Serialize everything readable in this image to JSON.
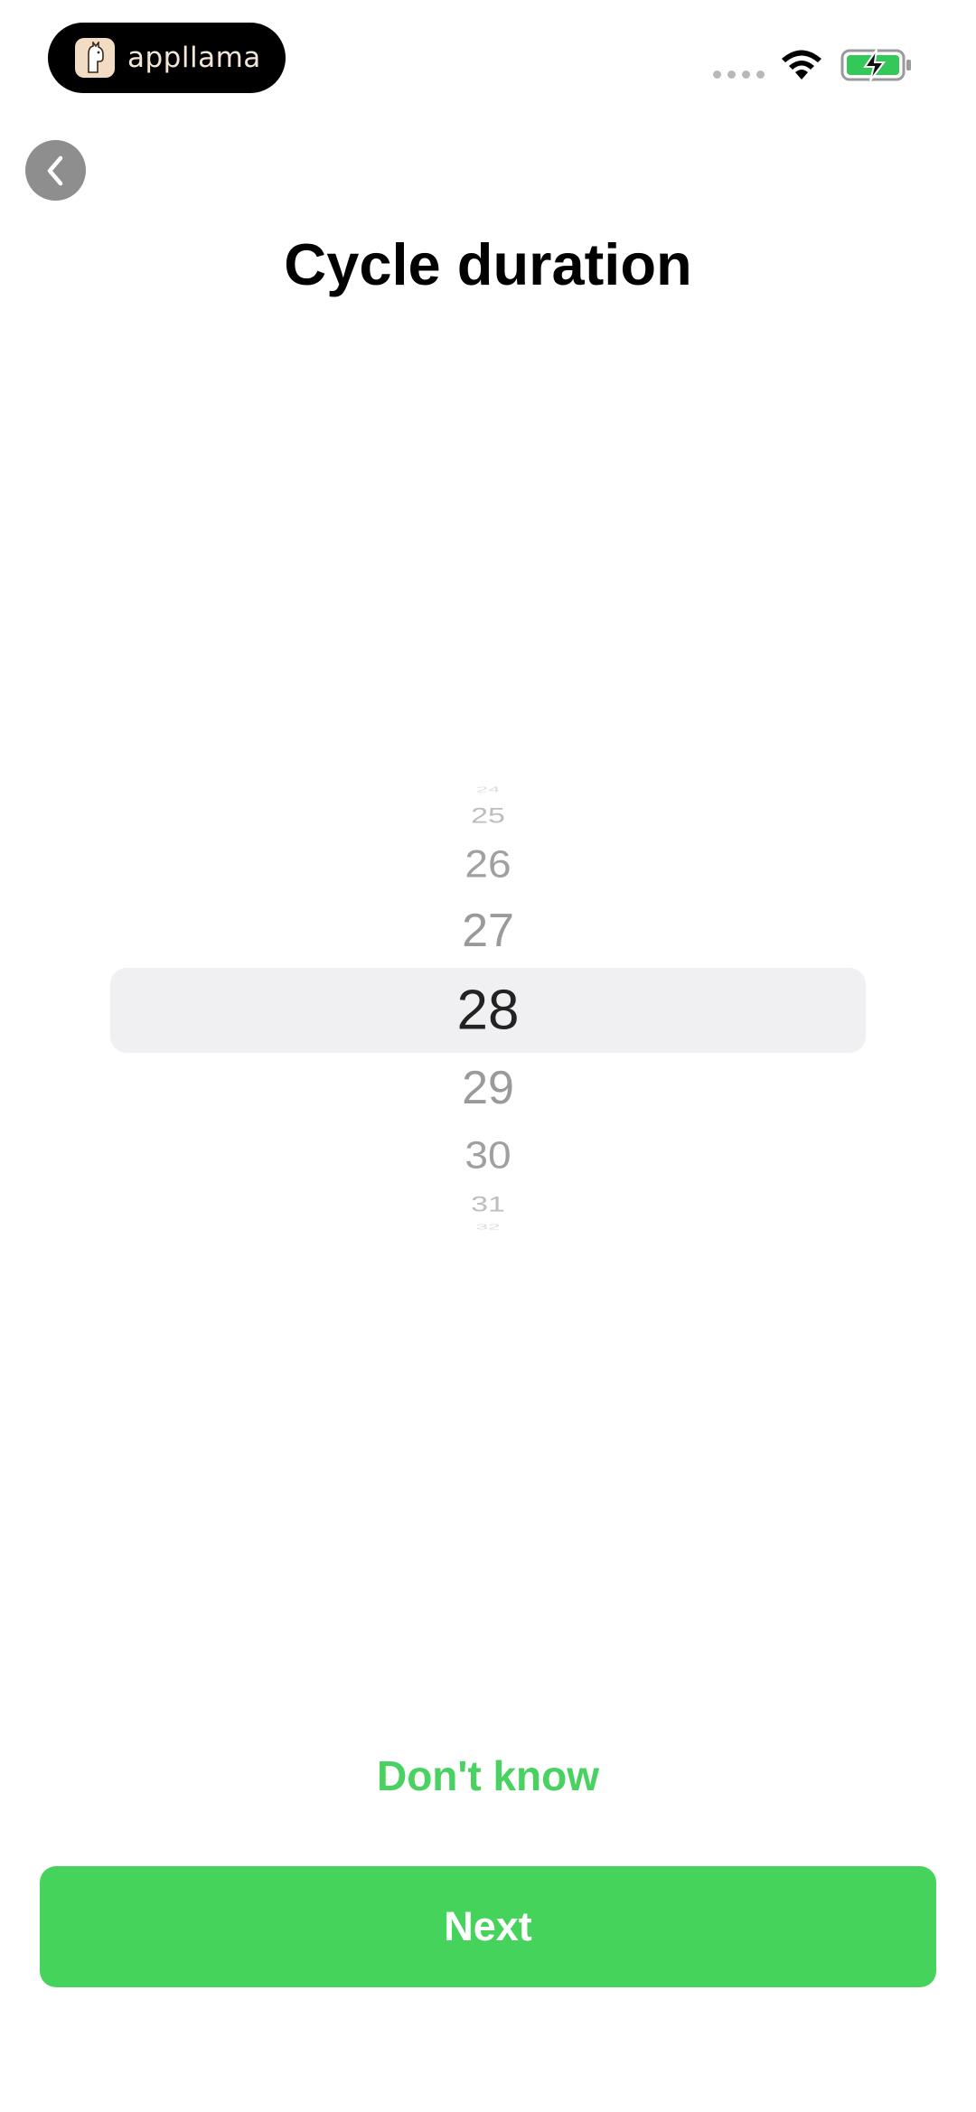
{
  "status_bar": {
    "brand_name": "appllama",
    "icons": [
      "signal-dots-icon",
      "wifi-icon",
      "battery-charging-icon"
    ],
    "battery_color": "#34c759"
  },
  "header": {
    "back_icon": "chevron-left-icon",
    "title": "Cycle duration"
  },
  "picker": {
    "selected": "28",
    "items": [
      "24",
      "25",
      "26",
      "27",
      "28",
      "29",
      "30",
      "31",
      "32"
    ]
  },
  "actions": {
    "dont_know_label": "Don't know",
    "next_label": "Next"
  },
  "colors": {
    "accent": "#45d35c",
    "selection_background": "#f0f0f2",
    "back_button": "#8e8e8e"
  }
}
